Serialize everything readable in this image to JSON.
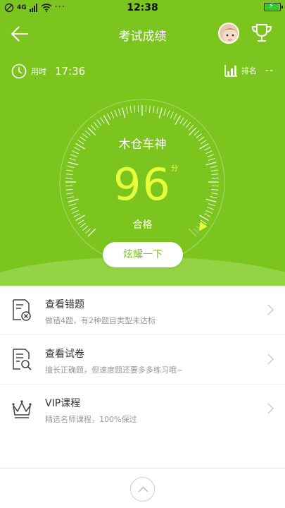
{
  "status_bar": {
    "time": "12:38",
    "signal_text": "4G"
  },
  "nav": {
    "title": "考试成绩"
  },
  "stats": {
    "used_time_label": "用时",
    "used_time_value": "17:36",
    "rank_label": "排名",
    "rank_value": "--"
  },
  "result": {
    "username": "木仓车神",
    "score": "96",
    "score_unit": "分",
    "status": "合格",
    "score_fraction": 0.96
  },
  "share_button": {
    "label": "炫耀一下"
  },
  "list": [
    {
      "title": "查看错题",
      "subtitle": "做错4题，有2种题目类型未达标",
      "icon": "wrong-questions-icon"
    },
    {
      "title": "查看试卷",
      "subtitle": "擅长正确题，但速度题还要多多练习哦~",
      "icon": "exam-paper-icon"
    },
    {
      "title": "VIP课程",
      "subtitle": "精选名师课程，100%保过",
      "icon": "crown-icon"
    }
  ],
  "colors": {
    "primary_green": "#7cc51f",
    "score_yellow": "#e6ff3b",
    "list_title": "#333333",
    "list_subtitle": "#999999"
  }
}
